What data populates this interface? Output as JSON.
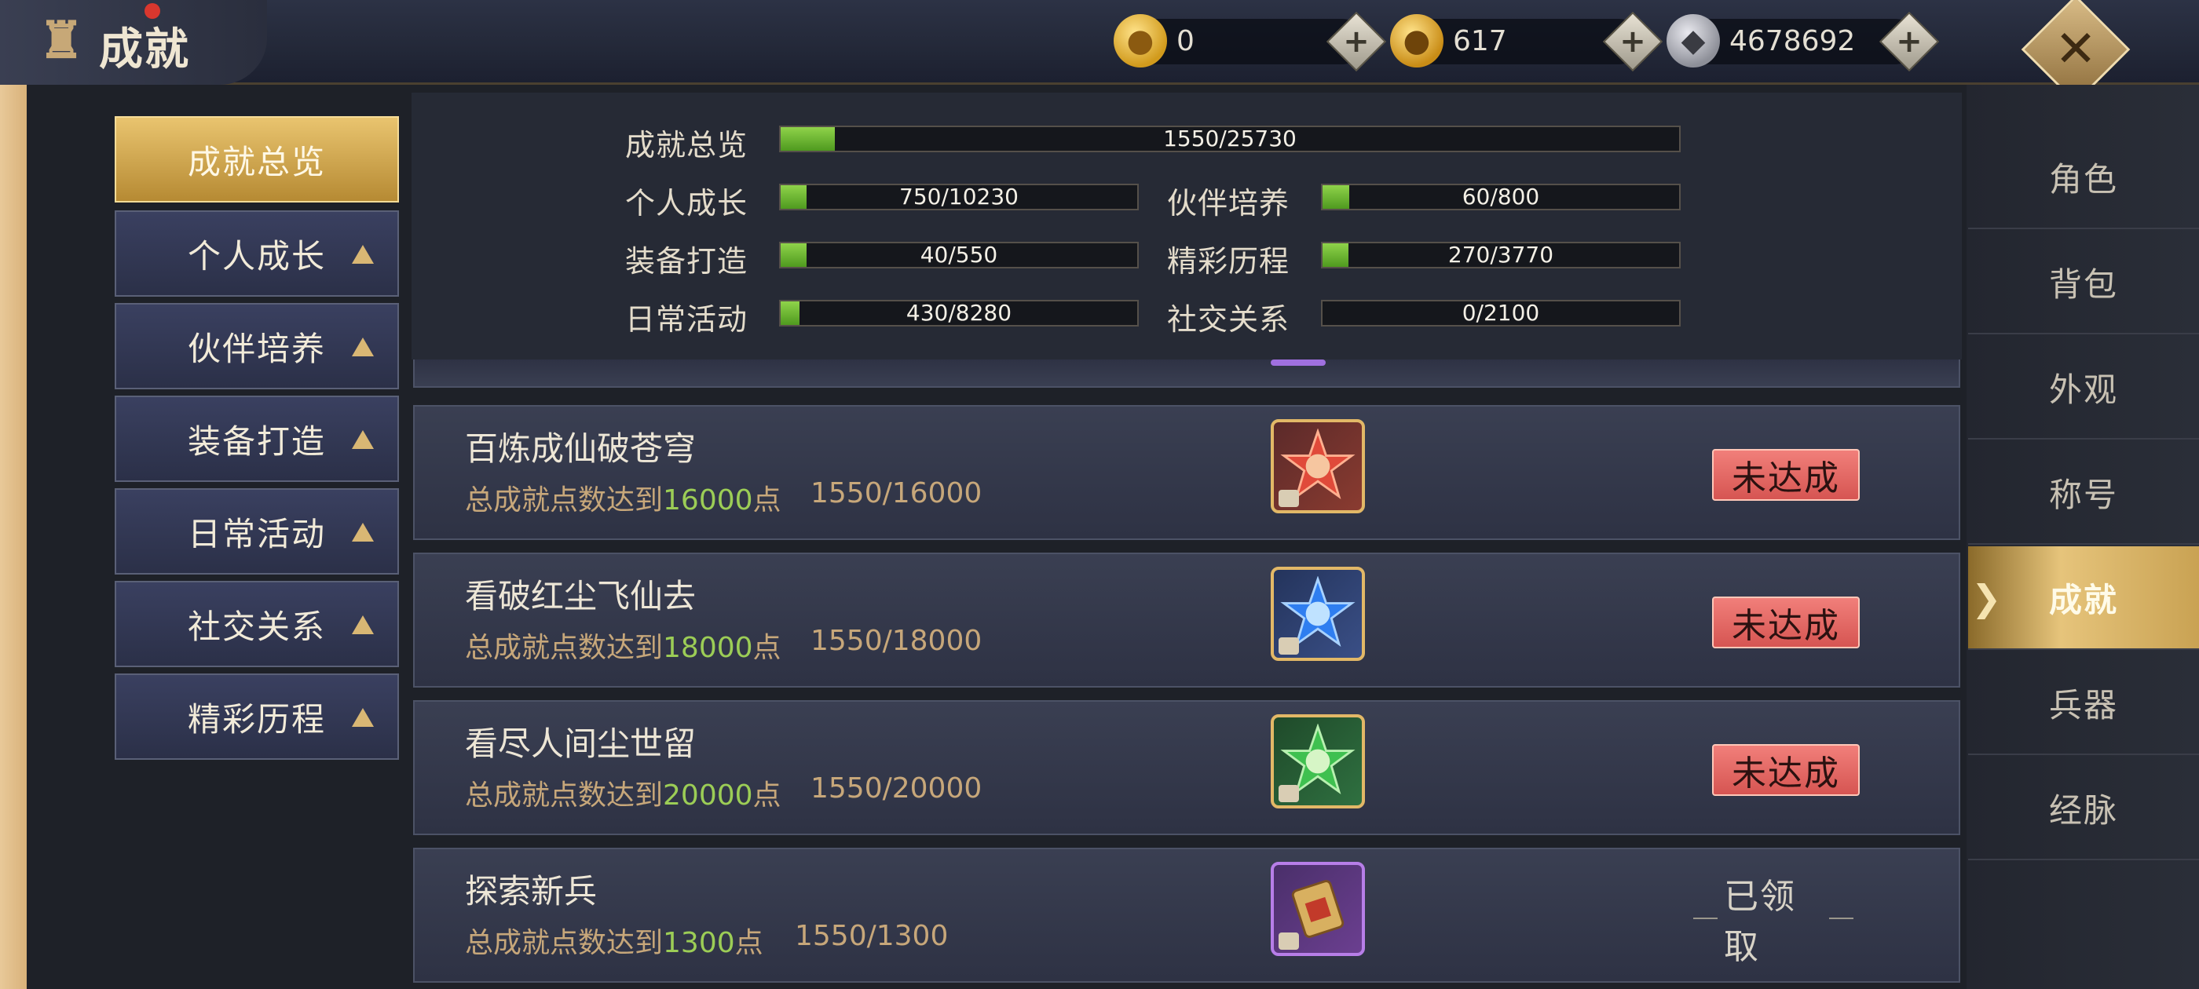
{
  "header": {
    "title": "成就",
    "currencies": [
      {
        "name": "gold-ingot",
        "value": "0"
      },
      {
        "name": "bound-gold-ingot",
        "value": "617"
      },
      {
        "name": "silver-coin",
        "value": "4678692"
      }
    ]
  },
  "nav": [
    {
      "label": "成就总览",
      "active": true
    },
    {
      "label": "个人成长",
      "active": false
    },
    {
      "label": "伙伴培养",
      "active": false
    },
    {
      "label": "装备打造",
      "active": false
    },
    {
      "label": "日常活动",
      "active": false
    },
    {
      "label": "社交关系",
      "active": false
    },
    {
      "label": "精彩历程",
      "active": false
    }
  ],
  "summary": {
    "total": {
      "label": "成就总览",
      "progress": "1550/25730",
      "fraction": 0.0602
    },
    "items": [
      {
        "label": "个人成长",
        "progress": "750/10230",
        "fraction": 0.0733
      },
      {
        "label": "伙伴培养",
        "progress": "60/800",
        "fraction": 0.075
      },
      {
        "label": "装备打造",
        "progress": "40/550",
        "fraction": 0.0727
      },
      {
        "label": "精彩历程",
        "progress": "270/3770",
        "fraction": 0.0716
      },
      {
        "label": "日常活动",
        "progress": "430/8280",
        "fraction": 0.0519
      },
      {
        "label": "社交关系",
        "progress": "0/2100",
        "fraction": 0.0
      }
    ]
  },
  "achievements": [
    {
      "title": "百炼成仙破苍穹",
      "desc_prefix": "总成就点数达到",
      "desc_value": "16000",
      "desc_suffix": "点",
      "progress": "1550/16000",
      "icon": "red-star-icon",
      "status": "未达成"
    },
    {
      "title": "看破红尘飞仙去",
      "desc_prefix": "总成就点数达到",
      "desc_value": "18000",
      "desc_suffix": "点",
      "progress": "1550/18000",
      "icon": "blue-star-icon",
      "status": "未达成"
    },
    {
      "title": "看尽人间尘世留",
      "desc_prefix": "总成就点数达到",
      "desc_value": "20000",
      "desc_suffix": "点",
      "progress": "1550/20000",
      "icon": "green-star-icon",
      "status": "未达成"
    },
    {
      "title": "探索新兵",
      "desc_prefix": "总成就点数达到",
      "desc_value": "1300",
      "desc_suffix": "点",
      "progress": "1550/1300",
      "icon": "scroll-icon",
      "status": "已领取"
    }
  ],
  "tabs": [
    {
      "label": "角色",
      "active": false
    },
    {
      "label": "背包",
      "active": false
    },
    {
      "label": "外观",
      "active": false
    },
    {
      "label": "称号",
      "active": false
    },
    {
      "label": "成就",
      "active": true
    },
    {
      "label": "兵器",
      "active": false
    },
    {
      "label": "经脉",
      "active": false
    }
  ],
  "colors": {
    "accent_gold": "#e9c46f",
    "progress_green": "#8fd34a",
    "status_red": "#e46a66",
    "highlight_green": "#9ccd56"
  }
}
